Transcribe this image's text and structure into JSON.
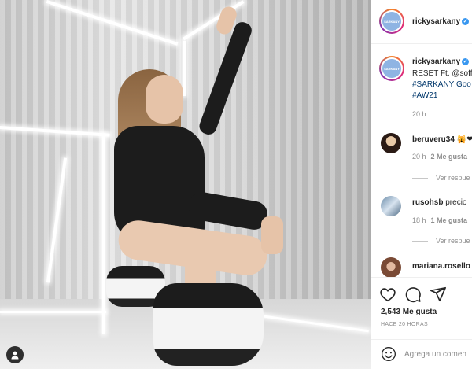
{
  "post": {
    "author": "rickysarkany",
    "avatar_text": "SARKANY",
    "caption": {
      "user": "rickysarkany",
      "line1": "RESET Ft. @soffi",
      "line2": "#SARKANY Goo",
      "line3": "#AW21",
      "time": "20 h"
    },
    "comments": [
      {
        "user": "beruveru34",
        "text": "🙀❤",
        "time": "20 h",
        "likes": "2 Me gusta",
        "replies": "Ver respue"
      },
      {
        "user": "rusohsb",
        "text": "precio",
        "time": "18 h",
        "likes": "1 Me gusta",
        "replies": "Ver respue"
      },
      {
        "user": "mariana.rosello",
        "text": "",
        "time": "",
        "likes": "",
        "replies": ""
      }
    ],
    "likes": "2,543 Me gusta",
    "posted": "HACE 20 HORAS"
  },
  "comment_box": {
    "placeholder": "Agrega un comen"
  },
  "colors": {
    "verified": "#3897f0",
    "link": "#00376b",
    "muted": "#8e8e8e"
  },
  "icons": [
    "user-tag-icon",
    "verified-badge-icon",
    "heart-icon",
    "comment-icon",
    "share-icon",
    "emoji-icon"
  ]
}
